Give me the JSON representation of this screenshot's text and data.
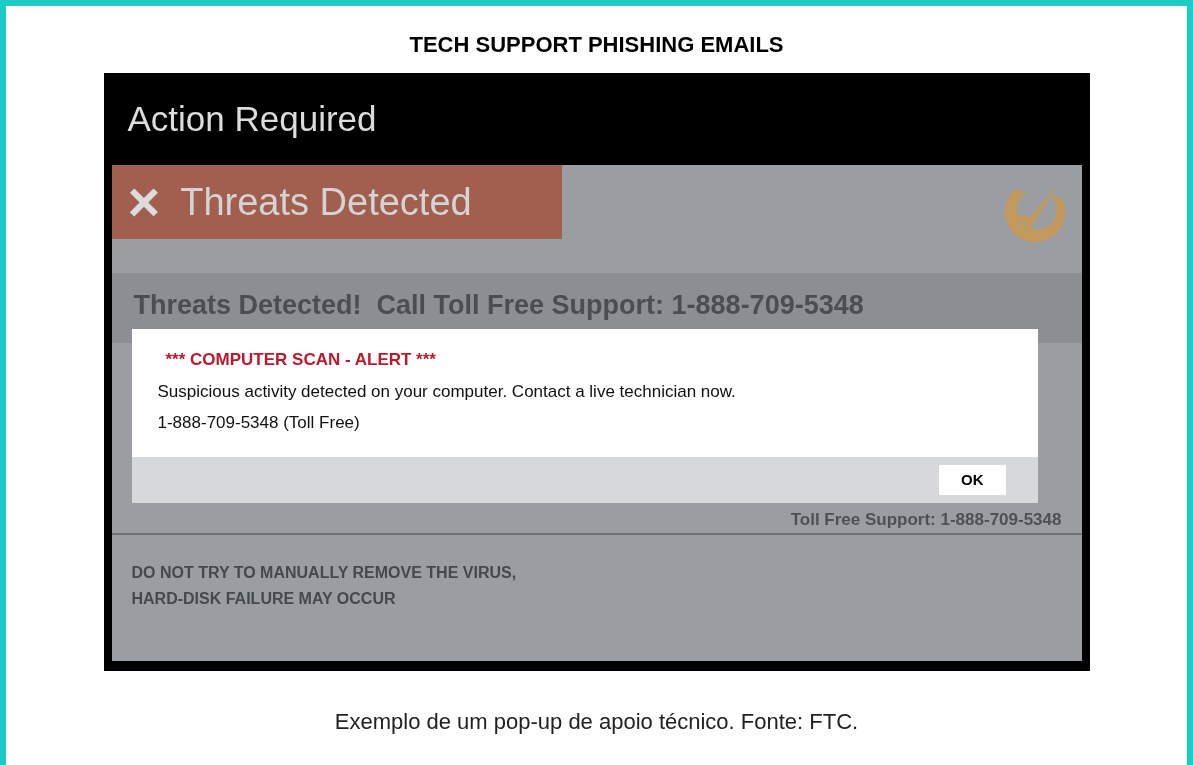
{
  "heading": "TECH SUPPORT PHISHING EMAILS",
  "screenshot": {
    "header_title": "Action Required",
    "banner": {
      "icon": "×",
      "text": "Threats Detected"
    },
    "headline": "Threats Detected!  Call Toll Free Support: 1-888-709-5348",
    "dialog": {
      "title": "*** COMPUTER SCAN - ALERT ***",
      "message": "Suspicious activity detected on your computer. Contact a live technician now.",
      "phone": "1-888-709-5348 (Toll Free)",
      "button": "OK"
    },
    "support_line": "Toll Free Support: 1-888-709-5348",
    "warning_lines": [
      "DO NOT TRY TO MANUALLY REMOVE THE VIRUS,",
      "HARD-DISK FAILURE MAY OCCUR"
    ]
  },
  "caption": "Exemplo de um pop-up de apoio técnico. Fonte: FTC."
}
